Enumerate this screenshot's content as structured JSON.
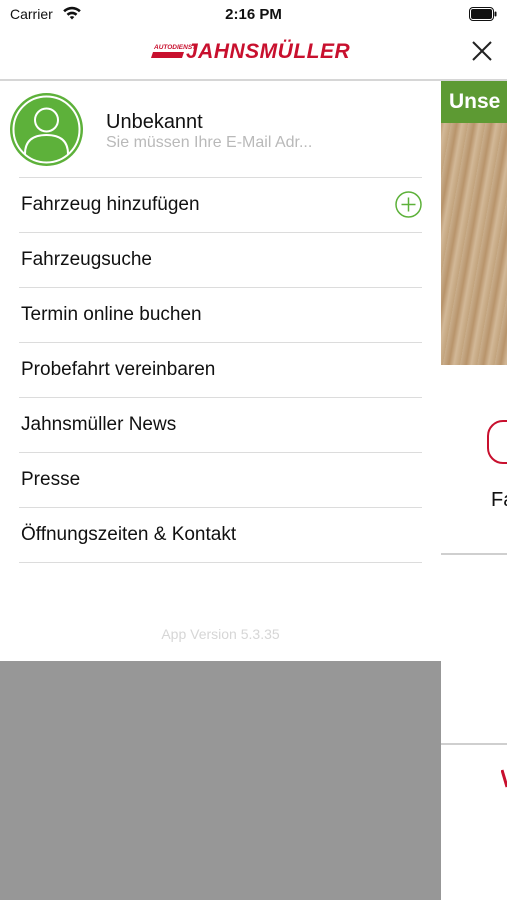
{
  "status_bar": {
    "carrier": "Carrier",
    "time": "2:16 PM"
  },
  "header": {
    "logo_small": "AUTODIENST",
    "logo_main": "JAHNSMÜLLER",
    "brand_color": "#c8102e"
  },
  "profile": {
    "name": "Unbekannt",
    "subtitle": "Sie müssen Ihre E-Mail Adr..."
  },
  "menu": {
    "items": [
      {
        "label": "Fahrzeug hinzufügen",
        "icon": "plus-circle-icon"
      },
      {
        "label": "Fahrzeugsuche"
      },
      {
        "label": "Termin online buchen"
      },
      {
        "label": "Probefahrt vereinbaren"
      },
      {
        "label": "Jahnsmüller News"
      },
      {
        "label": "Presse"
      },
      {
        "label": "Öffnungszeiten & Kontakt"
      }
    ]
  },
  "app_version": "App Version 5.3.35",
  "background_page": {
    "banner_text": "Unse",
    "text_fragment": "Fa",
    "accent_green": "#5d9a33"
  }
}
